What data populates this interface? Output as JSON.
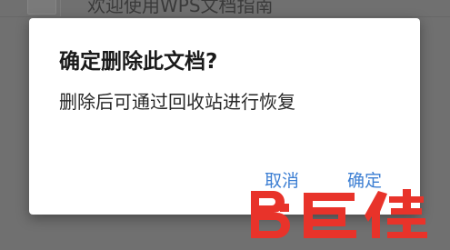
{
  "background": {
    "list_item_title": "欢迎使用WPS文档指南"
  },
  "dialog": {
    "title": "确定删除此文档?",
    "message": "删除后可通过回收站进行恢复",
    "cancel_label": "取消",
    "confirm_label": "确定"
  },
  "watermark": {
    "brand_text": "BJ巨佳"
  },
  "colors": {
    "overlay": "#707070",
    "dialog_bg": "#ffffff",
    "accent": "#3d7fd3",
    "watermark": "#e8332a"
  }
}
